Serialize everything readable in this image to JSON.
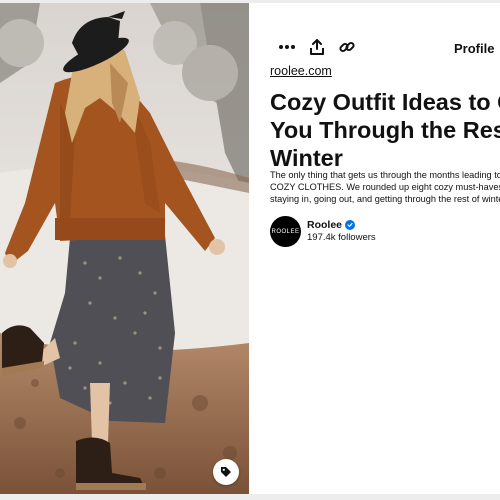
{
  "toolbar": {
    "more_icon": "more-dots-icon",
    "share_icon": "share-upload-icon",
    "link_icon": "link-icon",
    "profile_label": "Profile",
    "profile_chevron_icon": "chevron-down-icon"
  },
  "pin": {
    "source": "roolee.com",
    "title_lines": [
      "Cozy Outfit Ideas to Get",
      "You Through the Rest of",
      "Winter"
    ],
    "description_lines": [
      "The only thing that gets us through the months leading to spring?",
      "COZY CLOTHES. We rounded up eight cozy must-haves for",
      "staying in, going out, and getting through the rest of winter."
    ],
    "image_tag_icon": "tag-icon"
  },
  "creator": {
    "avatar_text": "ROOLEE",
    "name": "Roolee",
    "verified_icon": "verified-check-icon",
    "followers": "197.4k followers"
  },
  "colors": {
    "verified": "#0074e8",
    "jacket": "#a4541f",
    "background": "#ededed"
  }
}
